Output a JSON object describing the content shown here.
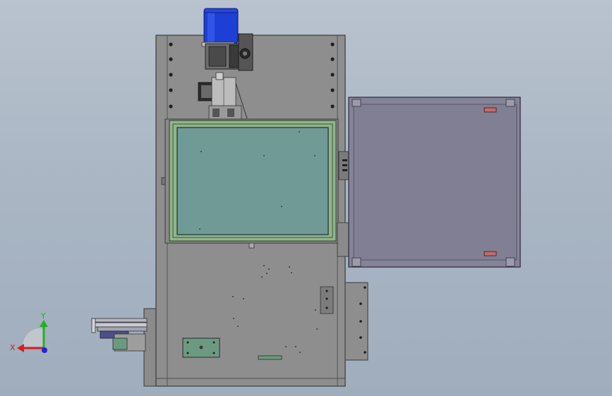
{
  "viewport": {
    "background_top": "#b9c3cf",
    "background_bottom": "#9fadbd"
  },
  "colors": {
    "frame_gray": "#8e8e8e",
    "frame_edge": "#3c3c3c",
    "motor_blue": "#1e3fd6",
    "screen_teal": "#6f9a96",
    "bezel_green": "#8fb68a",
    "cabinet_purple": "#848398",
    "latch_red": "#c46a6a",
    "axis_x": "#d81e1e",
    "axis_y": "#22b022",
    "axis_z": "#2222e0"
  },
  "triad": {
    "x_label": "X",
    "y_label": "Y"
  }
}
